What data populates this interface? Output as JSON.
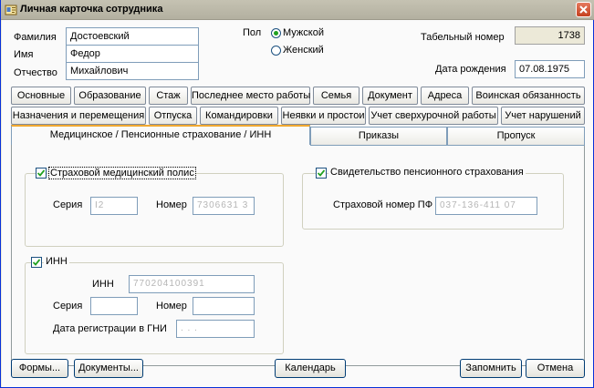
{
  "window": {
    "title": "Личная карточка сотрудника",
    "icons": {
      "app": "card-icon",
      "close": "close-icon"
    }
  },
  "person": {
    "surname_label": "Фамилия",
    "surname": "Достоевский",
    "name_label": "Имя",
    "name": "Федор",
    "patronymic_label": "Отчество",
    "patronymic": "Михайлович",
    "gender_label": "Пол",
    "gender_male": "Мужской",
    "gender_female": "Женский",
    "gender_selected": "Мужской",
    "tab_number_label": "Табельный номер",
    "tab_number": "1738",
    "birth_label": "Дата рождения",
    "birth_date": "07.08.1975"
  },
  "tabs_row1": [
    "Основные",
    "Образование",
    "Стаж",
    "Последнее место работы",
    "Семья",
    "Документ",
    "Адреса",
    "Воинская обязанность"
  ],
  "tabs_row2": [
    "Назначения и перемещения",
    "Отпуска",
    "Командировки",
    "Неявки и простои",
    "Учет сверхурочной работы",
    "Учет нарушений"
  ],
  "subtabs": [
    "Медицинское / Пенсионные страхование / ИНН",
    "Приказы",
    "Пропуск"
  ],
  "subtab_active": "Медицинское / Пенсионные страхование / ИНН",
  "medical": {
    "checkbox_label": "Страховой медицинский полис",
    "checked": true,
    "series_label": "Серия",
    "series_value": "I2",
    "number_label": "Номер",
    "number_value": "7306631 3"
  },
  "pension": {
    "checkbox_label": "Свидетельство пенсионного страхования",
    "checked": true,
    "number_label": "Страховой номер ПФ",
    "number_value": "037-136-411 07"
  },
  "inn": {
    "checkbox_label": "ИНН",
    "checked": true,
    "inn_label": "ИНН",
    "inn_value": "770204100391",
    "series_label": "Серия",
    "series_value": "",
    "number_label": "Номер",
    "number_value": "",
    "reg_label": "Дата регистрации в ГНИ",
    "reg_value": ". . ."
  },
  "buttons": {
    "forms": "Формы...",
    "documents": "Документы...",
    "calendar": "Календарь",
    "save": "Запомнить",
    "cancel": "Отмена"
  },
  "colors": {
    "active_tab_accent": "#f1a82f",
    "close_button": "#c4401f",
    "check_mark": "#21a121"
  }
}
